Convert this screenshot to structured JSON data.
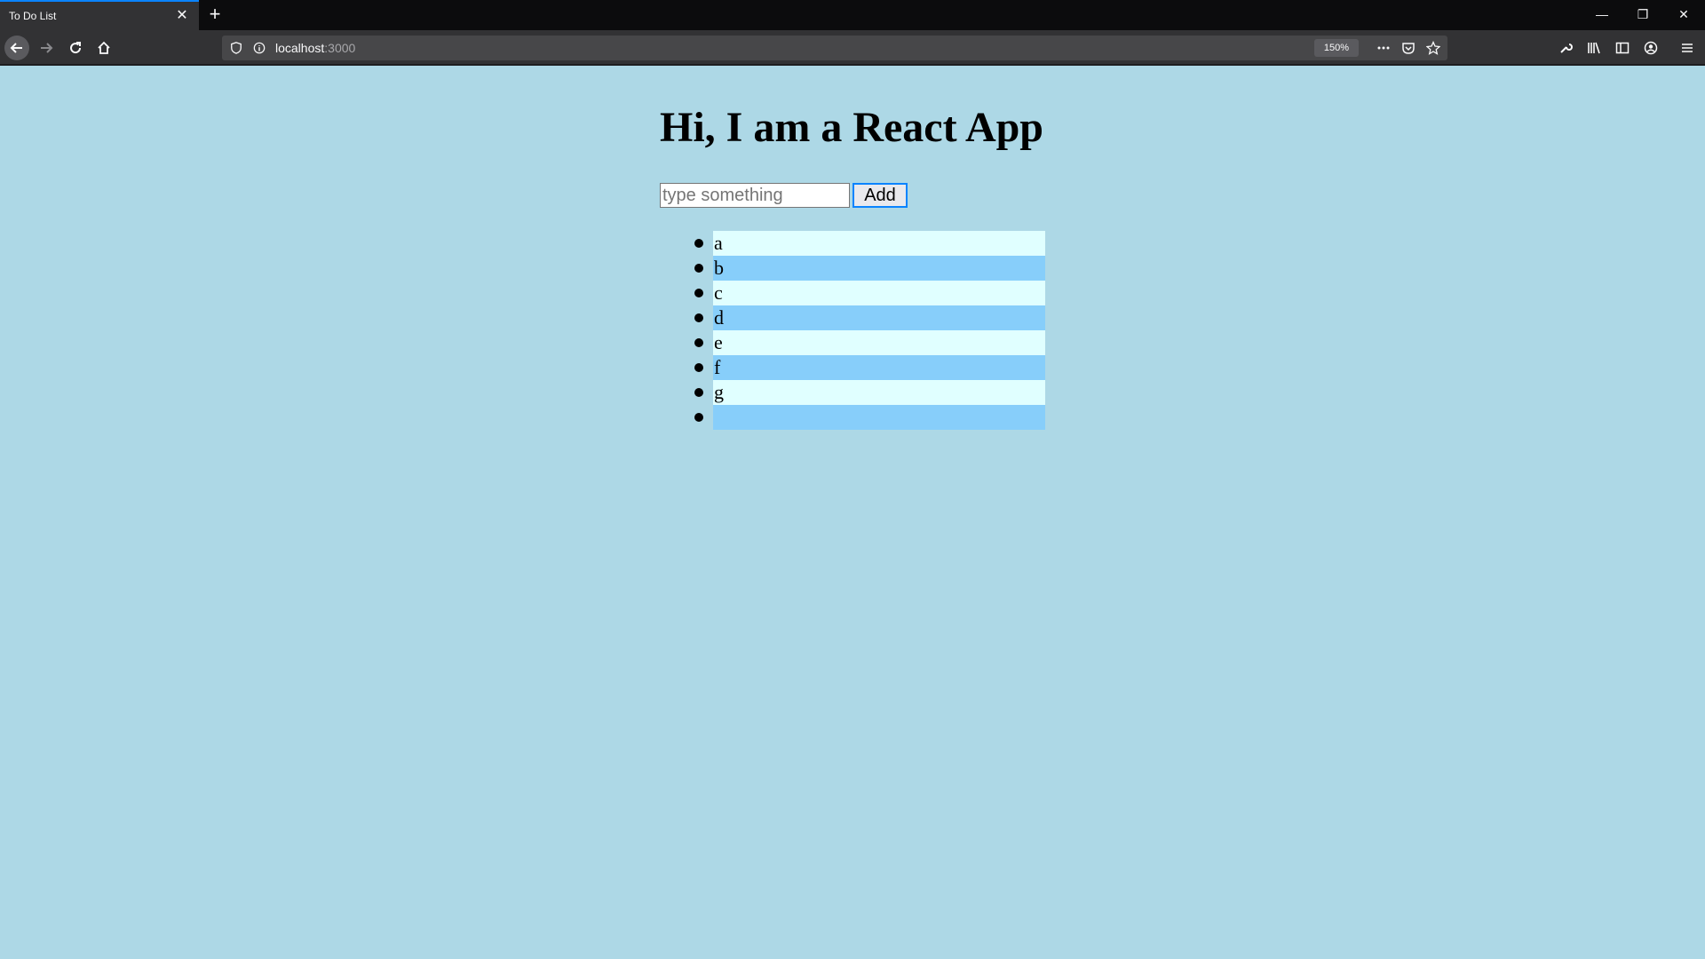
{
  "browser": {
    "tab_title": "To Do List",
    "tab_close": "✕",
    "new_tab": "+",
    "url_host": "localhost",
    "url_port": ":3000",
    "zoom": "150%",
    "win_min": "—",
    "win_restore": "❐",
    "win_close": "✕",
    "accent": "#0a84ff"
  },
  "app": {
    "title": "Hi, I am a React App",
    "input_placeholder": "type something",
    "input_value": "",
    "add_label": "Add",
    "background": "#add8e6",
    "row_colors": [
      "#e0ffff",
      "#87cefa"
    ],
    "items": [
      "a",
      "b",
      "c",
      "d",
      "e",
      "f",
      "g",
      ""
    ]
  }
}
